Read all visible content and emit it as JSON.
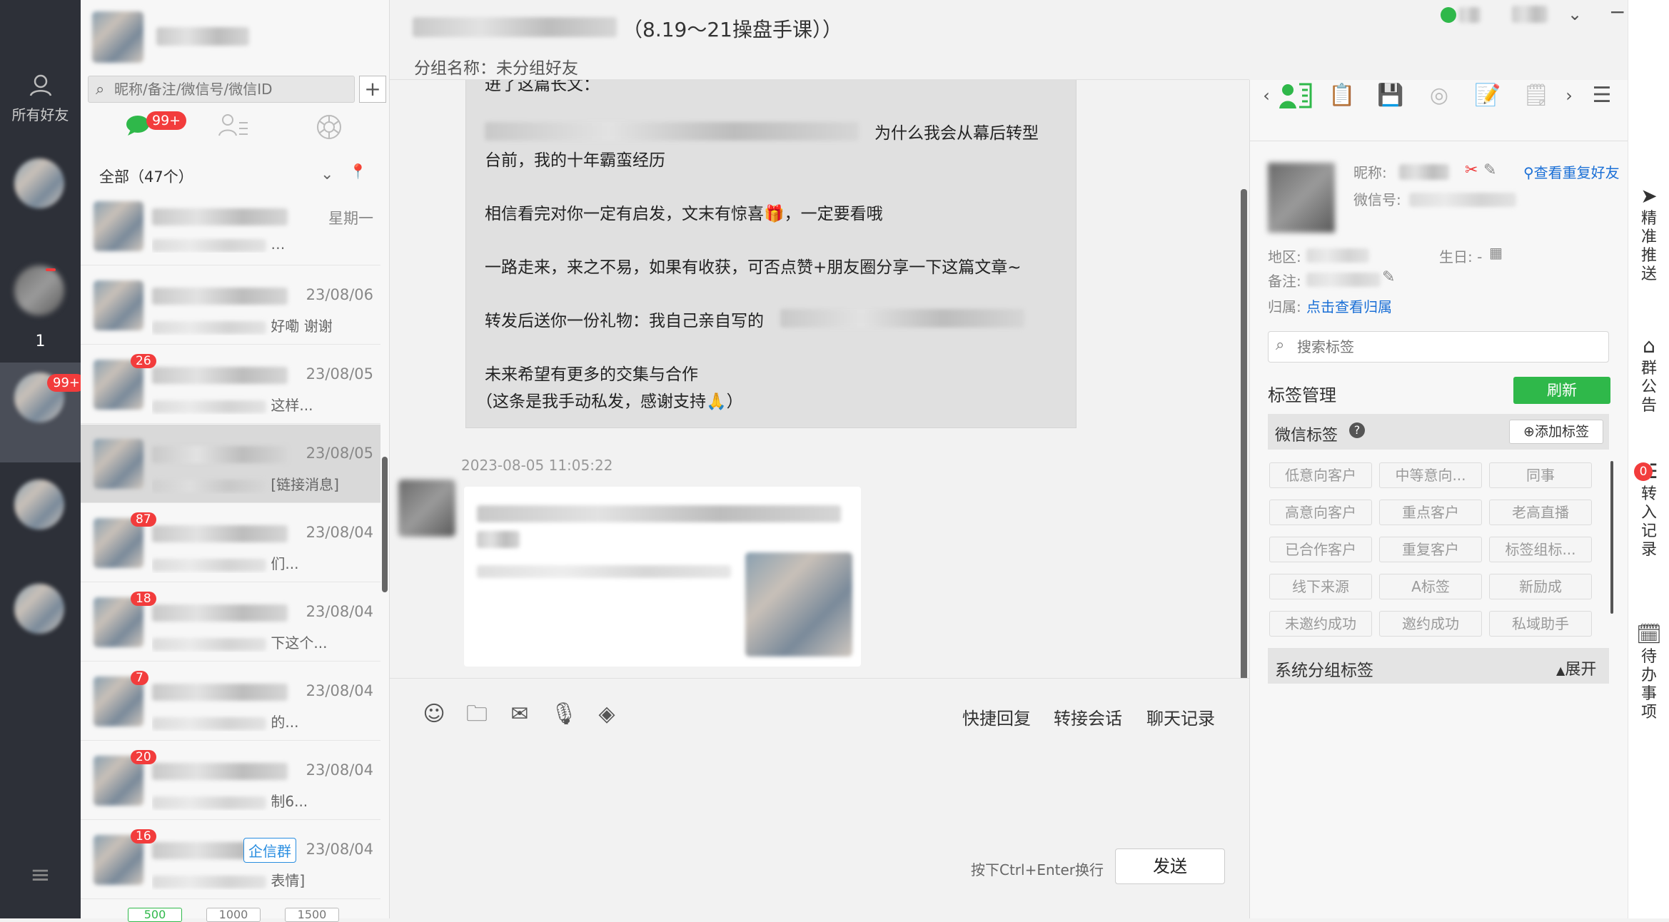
{
  "rail": {
    "all_friends_label": "所有好友",
    "count_label": "1",
    "badge_99": "99+"
  },
  "contacts": {
    "search_placeholder": "昵称/备注/微信号/微信ID",
    "add_btn": "+",
    "tab_badge": "99+",
    "filter_label": "全部（47个）",
    "items": [
      {
        "date": "星期一",
        "preview": "…",
        "badge": ""
      },
      {
        "date": "23/08/06",
        "preview": "好嘞 谢谢",
        "badge": ""
      },
      {
        "date": "23/08/05",
        "preview": "这样...",
        "badge": "26"
      },
      {
        "date": "23/08/05",
        "preview": "[链接消息]",
        "badge": ""
      },
      {
        "date": "23/08/04",
        "preview": "们...",
        "badge": "87"
      },
      {
        "date": "23/08/04",
        "preview": "下这个...",
        "badge": "18"
      },
      {
        "date": "23/08/04",
        "preview": "的...",
        "badge": "7"
      },
      {
        "date": "23/08/04",
        "preview": "制6...",
        "badge": "20"
      },
      {
        "date": "23/08/04",
        "preview": "表情]",
        "badge": "16",
        "tag": "企信群"
      }
    ],
    "page_buttons": [
      "500",
      "1000",
      "1500"
    ]
  },
  "chat": {
    "title_suffix": "（8.19～21操盘手课））",
    "group_label": "分组名称：未分组好友",
    "msg_lines": [
      "进了这篇长文：",
      "为什么我会从幕后转型",
      "台前，我的十年霸蛮经历",
      "相信看完对你一定有启发，文末有惊喜🎁，一定要看哦",
      "一路走来，来之不易，如果有收获，可否点赞+朋友圈分享一下这篇文章~",
      "转发后送你一份礼物：我自己亲自写的",
      "未来希望有更多的交集与合作",
      "（这条是我手动私发，感谢支持🙏）"
    ],
    "timestamp": "2023-08-05 11:05:22",
    "quick_reply": "快捷回复",
    "transfer": "转接会话",
    "history": "聊天记录",
    "hint": "按下Ctrl+Enter换行",
    "send": "发送"
  },
  "info": {
    "nick_label": "昵称:",
    "wx_label": "微信号:",
    "dup_link": "查看重复好友",
    "region_label": "地区:",
    "birthday_label": "生日: -",
    "remark_label": "备注:",
    "owner_label": "归属:",
    "owner_link": "点击查看归属",
    "tag_search_placeholder": "搜索标签",
    "tag_mgmt": "标签管理",
    "refresh": "刷新",
    "wx_tags": "微信标签",
    "add_tag": "添加标签",
    "tags": [
      "低意向客户",
      "中等意向...",
      "同事",
      "高意向客户",
      "重点客户",
      "老高直播",
      "已合作客户",
      "重复客户",
      "标签组标...",
      "线下来源",
      "A标签",
      "新励成",
      "未邀约成功",
      "邀约成功",
      "私域助手"
    ],
    "sys_tags": "系统分组标签",
    "expand": "展开"
  },
  "sidebar": {
    "push": [
      "精",
      "准",
      "推",
      "送"
    ],
    "notice": [
      "群",
      "公",
      "告"
    ],
    "transfer": [
      "转",
      "入",
      "记",
      "录"
    ],
    "transfer_badge": "0",
    "todo": [
      "待",
      "办",
      "事",
      "项"
    ]
  },
  "colors": {
    "accent_green": "#2fb84a",
    "badge_red": "#f23c3c",
    "link_blue": "#1a6fd6",
    "rail_bg": "#2d3038"
  }
}
